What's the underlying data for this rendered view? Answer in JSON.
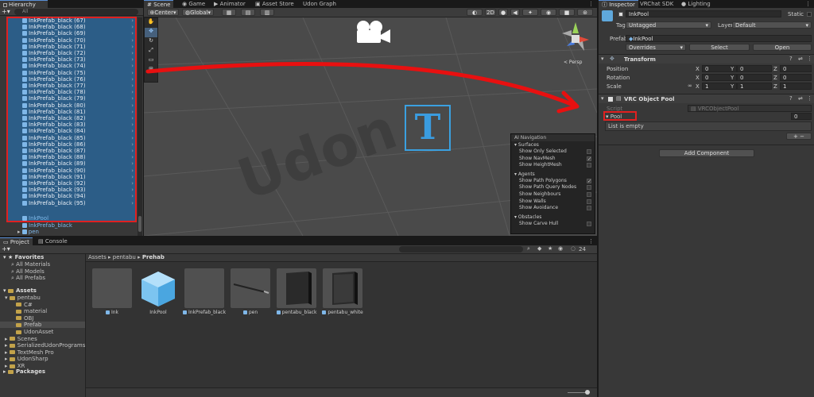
{
  "hierarchy": {
    "tab": "Hierarchy",
    "search_placeholder": "All",
    "items": [
      "InkPrefab_black (67)",
      "InkPrefab_black (68)",
      "InkPrefab_black (69)",
      "InkPrefab_black (70)",
      "InkPrefab_black (71)",
      "InkPrefab_black (72)",
      "InkPrefab_black (73)",
      "InkPrefab_black (74)",
      "InkPrefab_black (75)",
      "InkPrefab_black (76)",
      "InkPrefab_black (77)",
      "InkPrefab_black (78)",
      "InkPrefab_black (79)",
      "InkPrefab_black (80)",
      "InkPrefab_black (81)",
      "InkPrefab_black (82)",
      "InkPrefab_black (83)",
      "InkPrefab_black (84)",
      "InkPrefab_black (85)",
      "InkPrefab_black (86)",
      "InkPrefab_black (87)",
      "InkPrefab_black (88)",
      "InkPrefab_black (89)",
      "InkPrefab_black (90)",
      "InkPrefab_black (91)",
      "InkPrefab_black (92)",
      "InkPrefab_black (93)",
      "InkPrefab_black (94)",
      "InkPrefab_black (95)"
    ],
    "after_items": [
      "InkPool",
      "InkPrefab_black",
      "pen"
    ]
  },
  "scene": {
    "tabs": [
      "Scene",
      "Game",
      "Animator",
      "Asset Store",
      "Udon Graph"
    ],
    "toolbar": {
      "pivot": "Center",
      "space": "Global",
      "mode_2d": "2D"
    },
    "persp_label": "< Persp",
    "ai_nav": {
      "title": "AI Navigation",
      "surfaces": "Surfaces",
      "surface_items": [
        {
          "label": "Show Only Selected",
          "checked": false
        },
        {
          "label": "Show NavMesh",
          "checked": true
        },
        {
          "label": "Show HeightMesh",
          "checked": false
        }
      ],
      "agents": "Agents",
      "agent_items": [
        {
          "label": "Show Path Polygons",
          "checked": true
        },
        {
          "label": "Show Path Query Nodes",
          "checked": false
        },
        {
          "label": "Show Neighbours",
          "checked": false
        },
        {
          "label": "Show Walls",
          "checked": false
        },
        {
          "label": "Show Avoidance",
          "checked": false
        }
      ],
      "obstacles": "Obstacles",
      "obstacle_items": [
        {
          "label": "Show Carve Hull",
          "checked": false
        }
      ]
    }
  },
  "inspector": {
    "tabs": [
      "Inspector",
      "VRChat SDK",
      "Lighting"
    ],
    "object_name": "InkPool",
    "static_label": "Static",
    "tag_label": "Tag",
    "tag_value": "Untagged",
    "layer_label": "Layer",
    "layer_value": "Default",
    "prefab_label": "Prefab",
    "prefab_value": "InkPool",
    "overrides_label": "Overrides",
    "select_label": "Select",
    "open_label": "Open",
    "transform_title": "Transform",
    "position_label": "Position",
    "rotation_label": "Rotation",
    "scale_label": "Scale",
    "position": [
      "0",
      "0",
      "0"
    ],
    "rotation": [
      "0",
      "0",
      "0"
    ],
    "scale": [
      "1",
      "1",
      "1"
    ],
    "pool_component_title": "VRC Object Pool",
    "script_label": "Script",
    "script_value": "VRCObjectPool",
    "pool_label": "Pool",
    "pool_count": "0",
    "list_empty": "List is empty",
    "add_component": "Add Component"
  },
  "project": {
    "tabs": [
      "Project",
      "Console"
    ],
    "badge_count": "24",
    "favorites_label": "Favorites",
    "favorites": [
      "All Materials",
      "All Models",
      "All Prefabs"
    ],
    "assets_label": "Assets",
    "tree": [
      {
        "label": "pentabu",
        "level": 1
      },
      {
        "label": "C#",
        "level": 2
      },
      {
        "label": "material",
        "level": 2
      },
      {
        "label": "OBJ",
        "level": 2
      },
      {
        "label": "Prefab",
        "level": 2,
        "selected": true
      },
      {
        "label": "UdonAsset",
        "level": 2
      },
      {
        "label": "Scenes",
        "level": 1
      },
      {
        "label": "SerializedUdonPrograms",
        "level": 1
      },
      {
        "label": "TextMesh Pro",
        "level": 1
      },
      {
        "label": "UdonSharp",
        "level": 1
      },
      {
        "label": "XR",
        "level": 1
      }
    ],
    "packages_label": "Packages",
    "breadcrumb": [
      "Assets",
      "pentabu",
      "Prehab"
    ],
    "assets": [
      "Ink",
      "InkPool",
      "InkPrefab_black",
      "pen",
      "pentabu_black",
      "pentabu_white"
    ]
  },
  "colors": {
    "selection": "#2c5d87",
    "highlight_border": "#e02020",
    "arrow": "#e81010",
    "accent": "#5a8fd6"
  }
}
